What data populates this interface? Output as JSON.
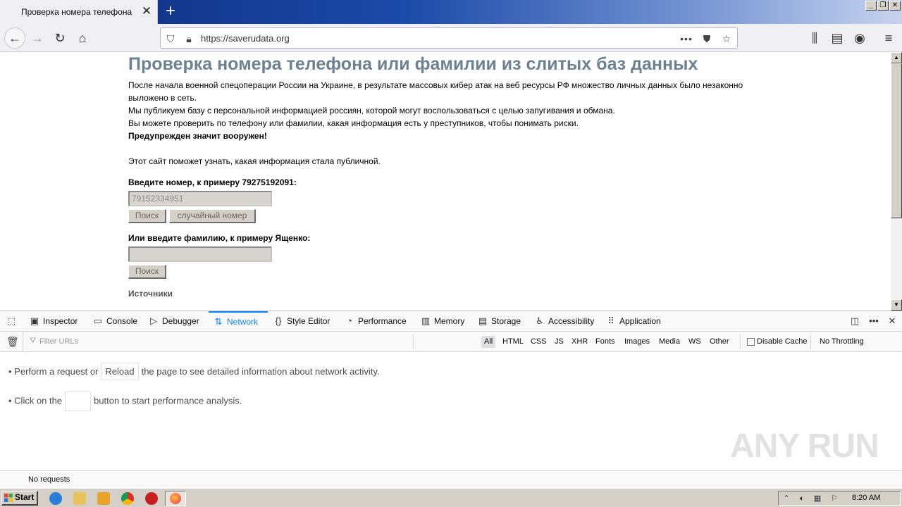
{
  "browser": {
    "tab_title": "Проверка номера телефона",
    "url": "https://saverudata.org"
  },
  "page": {
    "heading": "Проверка номера телефона или фамилии из слитых баз данных",
    "para1_line1": "После начала военной спецоперации России на Украине, в результате массовых кибер атак на веб ресурсы РФ множество личных данных было незаконно",
    "para1_line2": "выложено в сеть.",
    "para2": "Мы публикуем базу с персональной информацией россиян, которой могут воспользоваться с целью запугивания и обмана.",
    "para3": "Вы можете проверить по телефону или фамилии, какая информация есть у преступников, чтобы понимать риски.",
    "warning": "Предупрежден значит вооружен!",
    "para4": "Этот сайт поможет узнать, какая информация стала публичной.",
    "phone_label": "Введите номер, к примеру 79275192091:",
    "phone_placeholder": "79152334951",
    "search_label": "Поиск",
    "random_label": "случайный номер",
    "surname_label": "Или введите фамилию, к примеру Ященко:",
    "surname_value": "",
    "search2_label": "Поиск",
    "sources": "Источники"
  },
  "devtools": {
    "tabs": [
      {
        "label": "Inspector",
        "icon": "inspector-icon"
      },
      {
        "label": "Console",
        "icon": "console-icon"
      },
      {
        "label": "Debugger",
        "icon": "debugger-icon"
      },
      {
        "label": "Network",
        "icon": "network-icon"
      },
      {
        "label": "Style Editor",
        "icon": "style-editor-icon"
      },
      {
        "label": "Performance",
        "icon": "performance-icon"
      },
      {
        "label": "Memory",
        "icon": "memory-icon"
      },
      {
        "label": "Storage",
        "icon": "storage-icon"
      },
      {
        "label": "Accessibility",
        "icon": "accessibility-icon"
      },
      {
        "label": "Application",
        "icon": "application-icon"
      }
    ],
    "active_tab": "Network",
    "filter_placeholder": "Filter URLs",
    "filters": [
      "All",
      "HTML",
      "CSS",
      "JS",
      "XHR",
      "Fonts",
      "Images",
      "Media",
      "WS",
      "Other"
    ],
    "selected_filter": "All",
    "disable_cache": "Disable Cache",
    "throttling": "No Throttling",
    "msg1_pre": "• Perform a request or",
    "msg1_btn": "Reload",
    "msg1_post": "the page to see detailed information about network activity.",
    "msg2_pre": "• Click on the",
    "msg2_post": "button to start performance analysis.",
    "status": "No requests"
  },
  "watermark": "ANY RUN",
  "taskbar": {
    "start": "Start",
    "clock": "8:20 AM"
  },
  "colors": {
    "heading": "#6c8293",
    "devtools_accent": "#0a84ff",
    "taskbar": "#d4d0c8"
  }
}
